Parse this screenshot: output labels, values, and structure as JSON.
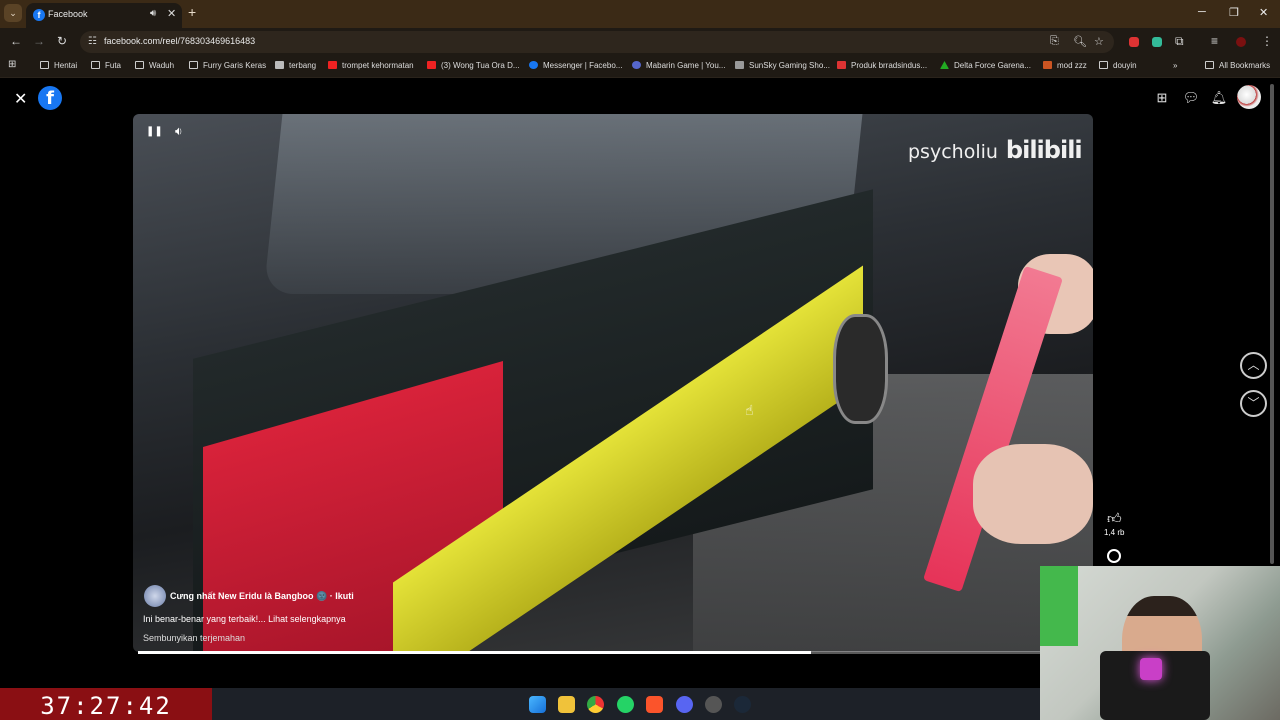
{
  "browser": {
    "tab_title": "Facebook",
    "url": "facebook.com/reel/768303469616483",
    "bookmarks": [
      {
        "label": "Hentai",
        "type": "folder"
      },
      {
        "label": "Futa",
        "type": "folder"
      },
      {
        "label": "Waduh",
        "type": "folder"
      },
      {
        "label": "Furry Garis Keras",
        "type": "folder"
      },
      {
        "label": "terbang",
        "type": "site"
      },
      {
        "label": "trompet kehormatan",
        "type": "youtube"
      },
      {
        "label": "(3) Wong Tua Ora D...",
        "type": "youtube"
      },
      {
        "label": "Messenger | Facebo...",
        "type": "facebook"
      },
      {
        "label": "Mabarin Game | You...",
        "type": "site"
      },
      {
        "label": "SunSky Gaming Sho...",
        "type": "site"
      },
      {
        "label": "Produk brradsindus...",
        "type": "site"
      },
      {
        "label": "Delta Force Garena...",
        "type": "site"
      },
      {
        "label": "mod zzz",
        "type": "site"
      },
      {
        "label": "douyin",
        "type": "folder"
      }
    ],
    "all_bookmarks": "All Bookmarks"
  },
  "reel": {
    "watermark_user": "psycholiu",
    "watermark_brand": "bilibili",
    "author": "Cưng nhất New Eridu là Bangboo 🌚 · Ikuti",
    "caption": "Ini benar-benar yang terbaik!... Lihat selengkapnya",
    "translation_toggle": "Sembunyikan terjemahan",
    "like_count": "1,4 rb",
    "progress": 0.74
  },
  "stream": {
    "timer": "37:27:42"
  },
  "colors": {
    "tab_strip": "#3b2a16",
    "toolbar": "#1f1a14",
    "facebook_blue": "#1877f2",
    "timer_bg": "#8a0f13"
  }
}
